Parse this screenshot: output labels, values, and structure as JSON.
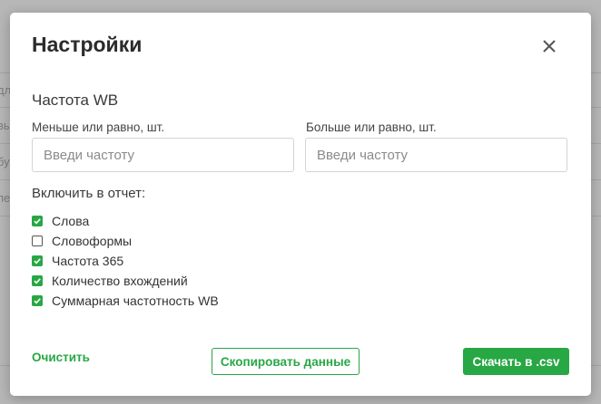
{
  "background": {
    "fragments": [
      "дл",
      "вы",
      "бу",
      "пе"
    ]
  },
  "modal": {
    "title": "Настройки",
    "close_icon": "close-x-icon",
    "section_title": "Частота WB",
    "min_field": {
      "label": "Меньше или равно, шт.",
      "placeholder": "Введи частоту",
      "value": ""
    },
    "max_field": {
      "label": "Больше или равно, шт.",
      "placeholder": "Введи частоту",
      "value": ""
    },
    "include_label": "Включить в отчет:",
    "options": [
      {
        "label": "Слова",
        "checked": true
      },
      {
        "label": "Словоформы",
        "checked": false
      },
      {
        "label": "Частота 365",
        "checked": true
      },
      {
        "label": "Количество вхождений",
        "checked": true
      },
      {
        "label": "Суммарная частотность WB",
        "checked": true
      }
    ],
    "buttons": {
      "clear": "Очистить",
      "copy": "Скопировать данные",
      "download": "Скачать в .csv"
    }
  },
  "colors": {
    "accent": "#28a745",
    "overlay": "rgba(110,110,110,0.45)"
  }
}
